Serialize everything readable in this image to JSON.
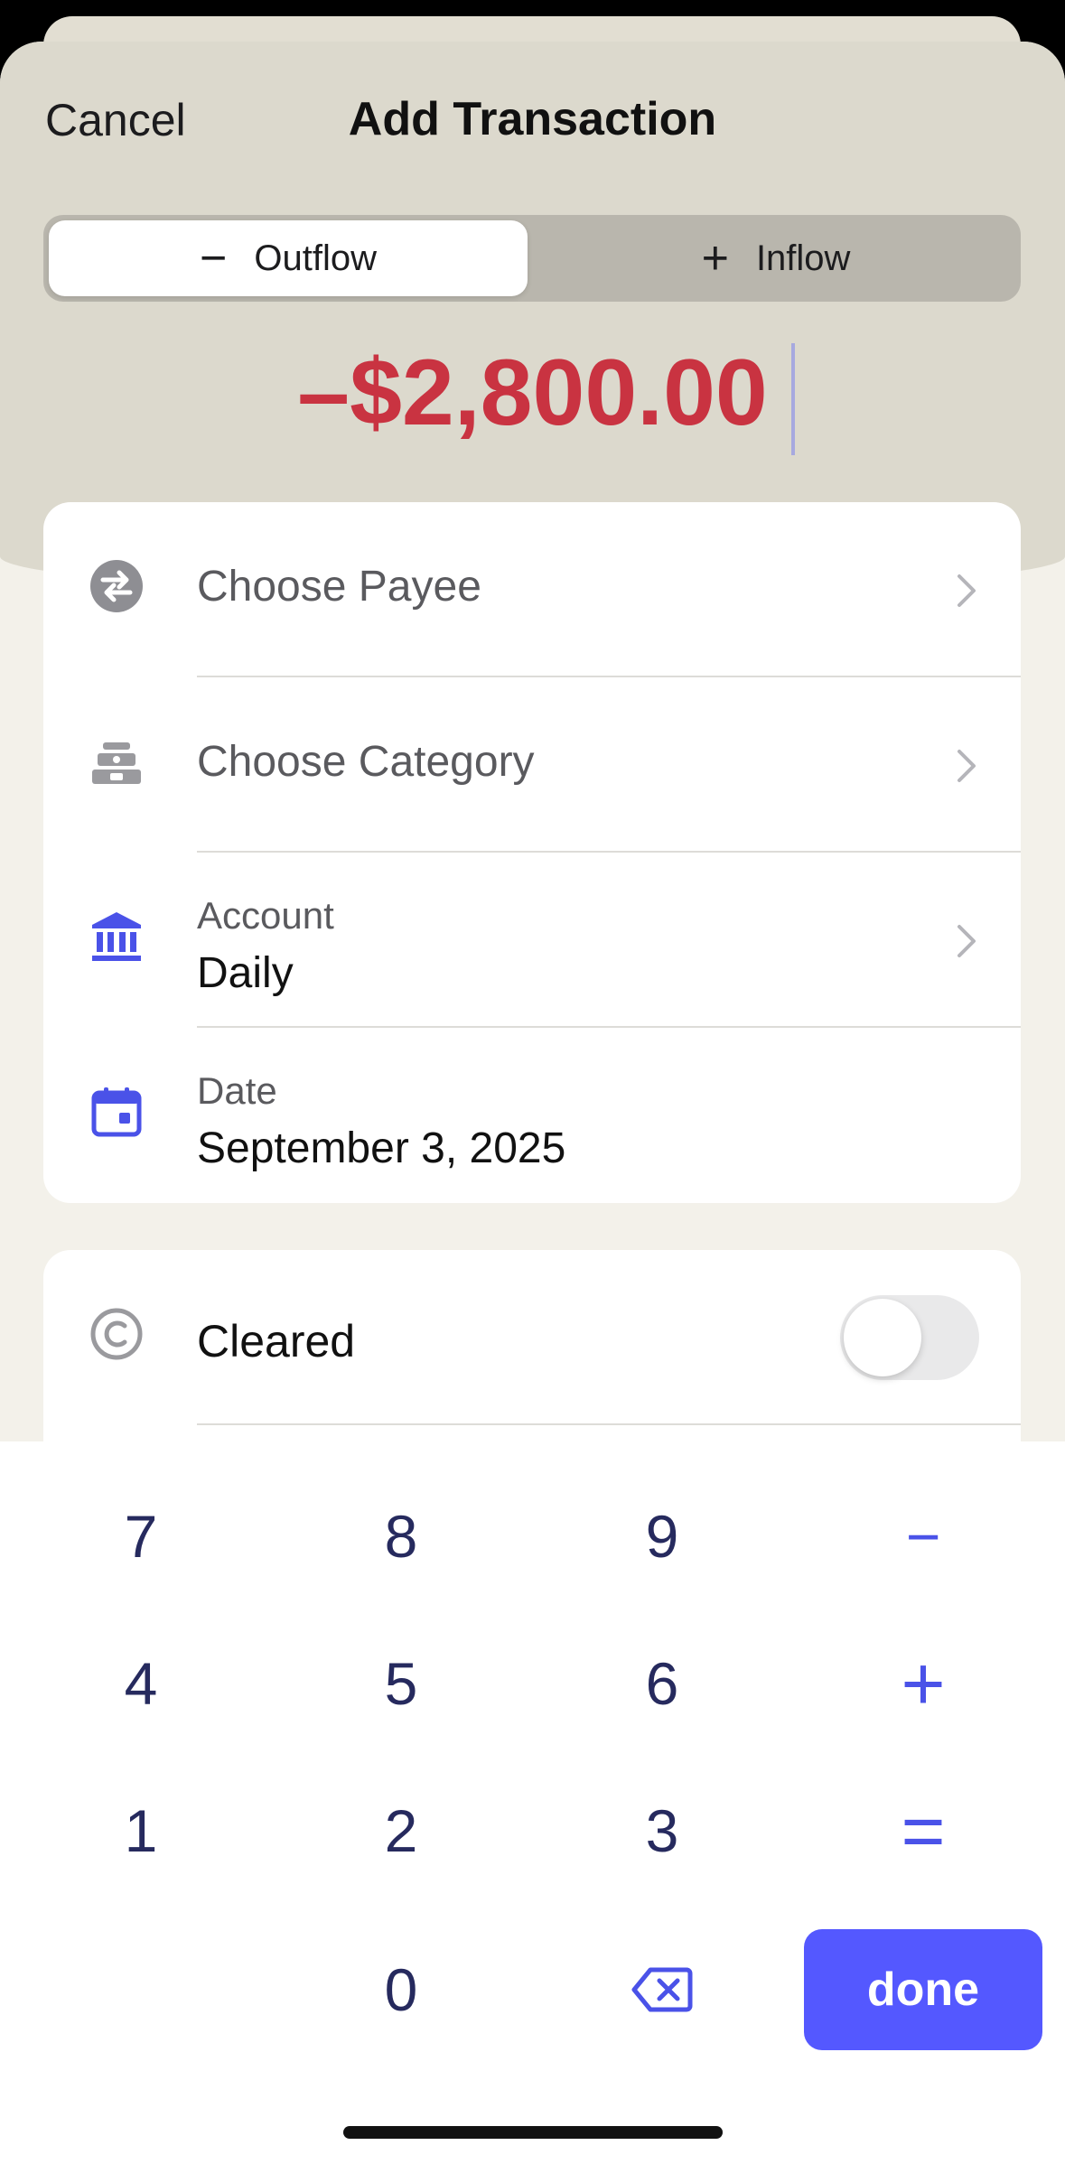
{
  "nav": {
    "cancel_label": "Cancel",
    "title": "Add Transaction"
  },
  "flow_toggle": {
    "outflow_glyph": "−",
    "outflow_label": "Outflow",
    "inflow_glyph": "+",
    "inflow_label": "Inflow",
    "selected": "Outflow"
  },
  "amount": {
    "display": "–$2,800.00",
    "color": "#c93341"
  },
  "fields": {
    "payee": {
      "label": "Choose Payee",
      "icon": "swap-arrows-icon"
    },
    "category": {
      "label": "Choose Category",
      "icon": "category-tray-icon"
    },
    "account": {
      "label": "Account",
      "value": "Daily",
      "icon": "bank-icon"
    },
    "date": {
      "label": "Date",
      "value": "September 3, 2025",
      "icon": "calendar-icon"
    }
  },
  "cleared": {
    "label": "Cleared",
    "icon": "copyright-circle-icon",
    "on": false
  },
  "keypad": {
    "keys": [
      "7",
      "8",
      "9",
      "4",
      "5",
      "6",
      "1",
      "2",
      "3",
      "0"
    ],
    "minus": "−",
    "plus": "+",
    "equals": "=",
    "backspace_icon": "backspace-icon",
    "done_label": "done"
  },
  "colors": {
    "accent": "#5458ff",
    "negative": "#c93341",
    "icon_blue": "#4a52e8",
    "icon_gray": "#8e8e93"
  }
}
